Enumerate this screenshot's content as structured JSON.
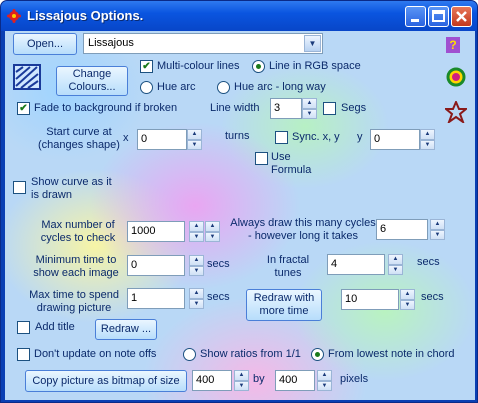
{
  "window": {
    "title": "Lissajous Options."
  },
  "top": {
    "open_label": "Open...",
    "preset_value": "Lissajous"
  },
  "colours": {
    "change_label": "Change Colours...",
    "multi_colour_label": "Multi-colour lines",
    "multi_colour_checked": true,
    "line_rgb_label": "Line in RGB space",
    "hue_arc_label": "Hue arc",
    "hue_arc_long_label": "Hue arc - long way",
    "fade_label": "Fade to background  if broken",
    "fade_checked": true
  },
  "line": {
    "width_label": "Line width",
    "width_value": "3",
    "segs_label": "Segs"
  },
  "curve": {
    "start_label": "Start curve at (changes shape)",
    "x_label": "x",
    "x_value": "0",
    "turns_label": "turns",
    "sync_label": "Sync. x, y",
    "y_label": "y",
    "y_value": "0",
    "use_formula_label": "Use Formula",
    "show_curve_label": "Show curve as it is drawn"
  },
  "cycles": {
    "max_label": "Max number of cycles to check",
    "max_value": "1000",
    "always_label": "Always draw this many cycles - however long it takes",
    "always_value": "6"
  },
  "timing": {
    "min_time_label": "Minimum time to show each image",
    "min_time_value": "0",
    "secs1": "secs",
    "fractal_label": "In fractal tunes",
    "fractal_value": "4",
    "secs2": "secs",
    "max_time_label": "Max time to spend drawing picture",
    "max_time_value": "1",
    "secs3": "secs",
    "redraw_more_label": "Redraw with more time",
    "more_time_value": "10",
    "secs4": "secs"
  },
  "misc": {
    "add_title_label": "Add title",
    "redraw_label": "Redraw ...",
    "dont_update_label": "Don't update on note offs",
    "ratios_label": "Show ratios from 1/1",
    "lowest_note_label": "From lowest note in chord"
  },
  "copy": {
    "button_label": "Copy picture as bitmap of size",
    "width_value": "400",
    "by_label": "by",
    "height_value": "400",
    "pixels_label": "pixels"
  }
}
